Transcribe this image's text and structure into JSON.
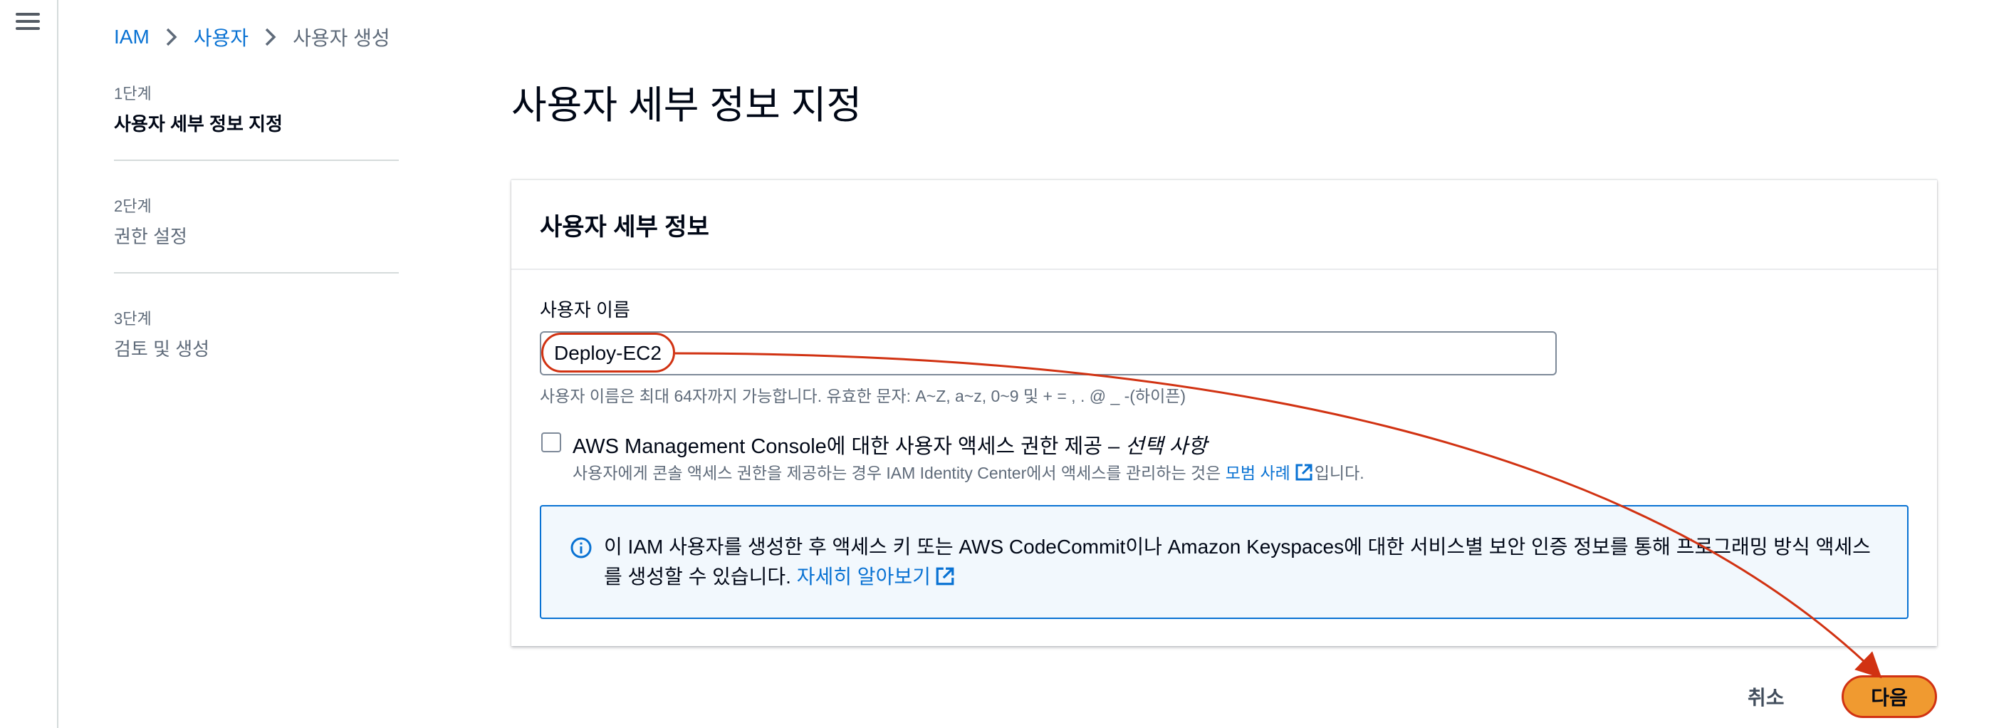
{
  "breadcrumb": {
    "items": [
      "IAM",
      "사용자"
    ],
    "current": "사용자 생성"
  },
  "steps": [
    {
      "num": "1단계",
      "title": "사용자 세부 정보 지정",
      "state": "active"
    },
    {
      "num": "2단계",
      "title": "권한 설정",
      "state": "inactive"
    },
    {
      "num": "3단계",
      "title": "검토 및 생성",
      "state": "inactive"
    }
  ],
  "page": {
    "title": "사용자 세부 정보 지정"
  },
  "panel": {
    "title": "사용자 세부 정보",
    "username_label": "사용자 이름",
    "username_value": "Deploy-EC2",
    "username_hint": "사용자 이름은 최대 64자까지 가능합니다. 유효한 문자: A~Z, a~z, 0~9 및 + = , . @ _ -(하이픈)",
    "console_access_label": "AWS Management Console에 대한 사용자 액세스 권한 제공 – ",
    "console_access_optional": "선택 사항",
    "console_access_desc_before": "사용자에게 콘솔 액세스 권한을 제공하는 경우 IAM Identity Center에서 액세스를 관리하는 것은 ",
    "console_access_link": "모범 사례",
    "console_access_desc_after": "입니다.",
    "info_text": "이 IAM 사용자를 생성한 후 액세스 키 또는 AWS CodeCommit이나 Amazon Keyspaces에 대한 서비스별 보안 인증 정보를 통해 프로그래밍 방식 액세스를 생성할 수 있습니다. ",
    "info_link": "자세히 알아보기"
  },
  "actions": {
    "cancel": "취소",
    "next": "다음"
  },
  "colors": {
    "link": "#0972d3",
    "primary_button": "#f09a30",
    "annotation": "#d13212",
    "info_bg": "#f2f8fd"
  },
  "icons": [
    "menu-icon",
    "chevron-right-icon",
    "external-link-icon",
    "info-icon"
  ]
}
